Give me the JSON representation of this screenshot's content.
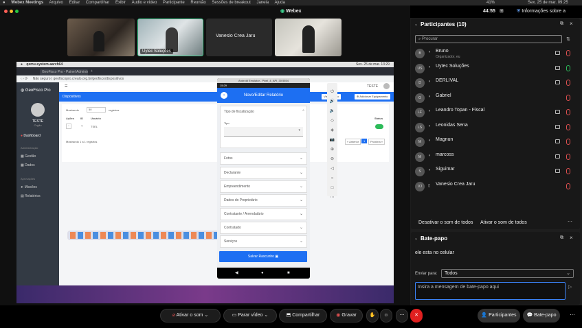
{
  "menubar": {
    "items": [
      "Webex Meetings",
      "Arquivo",
      "Editar",
      "Compartilhar",
      "Exibir",
      "Áudio e vídeo",
      "Participante",
      "Reunião",
      "Sessões de breakout",
      "Janela",
      "Ajuda"
    ],
    "battery": "41%",
    "datetime": "Sex. 25 de mar.  09:25"
  },
  "topbar": {
    "app": "Webex",
    "time": "44:55",
    "info": "Informações sobre a reunião"
  },
  "videos": [
    {
      "label": ""
    },
    {
      "label": "Uytec Soluções"
    },
    {
      "label": "Vanesio Crea Jaru"
    },
    {
      "label": ""
    }
  ],
  "share": {
    "guest_title": "qemu-system-aarch64",
    "guest_date": "Sex. 25 de mar.  13:29",
    "tab": "GeoFisco Pro - Painel Administrativo",
    "url": "Não seguro  |  geofiscopro.crealo.org.br/geofisco/dispositivos",
    "app_name": "GeoFisco Pro",
    "user": "TESTE",
    "user_role": "Orgão",
    "nav": [
      "Dashboard",
      "Administração",
      "Gestão",
      "Dados",
      "Aprovações",
      "Missões",
      "Relatórios"
    ],
    "page": "Dispositivos",
    "btn1": "Visualização",
    "btn2": "Adicionar Equipamento",
    "user_top": "TESTE",
    "show": "Mostrando",
    "per_page": "50",
    "records": "registros",
    "col_actions": "Ações",
    "col_id": "ID",
    "col_user": "Usuário",
    "col_status": "Status",
    "row_id": "1",
    "row_user": "TSEL",
    "footer": "Mostrando 1 a 1 registros",
    "prev": "« Anterior",
    "page_num": "1",
    "next": "Próxima »"
  },
  "phone": {
    "title": "Android Emulator - Pixel_4_API_30:5554",
    "status_time": "15:29",
    "header": "Novo/Editar Relatório",
    "tipo_fisc": "Tipo de fiscalização",
    "tipo": "Tipo",
    "sections": [
      "Fotos",
      "Declarante",
      "Empreendimento",
      "Dados do Proprietário",
      "Contratante / Arrendatário",
      "Contratado",
      "Serviços"
    ],
    "save": "Salvar Rascunho"
  },
  "participants": {
    "title": "Participantes (10)",
    "search_placeholder": "Procurar",
    "people": [
      {
        "initials": "B",
        "name": "Bruno",
        "sub": "Organizador, eu",
        "mic": "off"
      },
      {
        "initials": "US",
        "name": "Uytec Soluções",
        "sub": "",
        "mic": "on"
      },
      {
        "initials": "D",
        "name": "DERLIVAL",
        "sub": "",
        "mic": "off"
      },
      {
        "initials": "G",
        "name": "Gabriel",
        "sub": "",
        "mic": "off"
      },
      {
        "initials": "LF",
        "name": "Leandro Topan - Fiscal",
        "sub": "",
        "mic": "off"
      },
      {
        "initials": "LS",
        "name": "Leonidas Sena",
        "sub": "",
        "mic": "off"
      },
      {
        "initials": "M",
        "name": "Magnun",
        "sub": "",
        "mic": "off"
      },
      {
        "initials": "M",
        "name": "marcoss",
        "sub": "",
        "mic": "off"
      },
      {
        "initials": "S",
        "name": "Siguimar",
        "sub": "",
        "mic": "off"
      },
      {
        "initials": "VJ",
        "name": "Vanesio Crea Jaru",
        "sub": "",
        "mic": "off"
      }
    ],
    "mute_all": "Desativar o som de todos",
    "unmute_all": "Ativar o som de todos"
  },
  "chat": {
    "title": "Bate-papo",
    "message": "ele esta no celular",
    "send_to_label": "Enviar para:",
    "send_to": "Todos",
    "input_placeholder": "Insira a mensagem de bate-papo aqui"
  },
  "controls": {
    "audio": "Ativar o som",
    "video": "Parar vídeo",
    "share": "Compartilhar",
    "record": "Gravar",
    "participants": "Participantes",
    "chat": "Bate-papo"
  },
  "colors": {
    "accent": "#1d6ff2",
    "mic_off": "#e05050",
    "mic_on": "#2dbb5a",
    "end": "#e02020"
  }
}
